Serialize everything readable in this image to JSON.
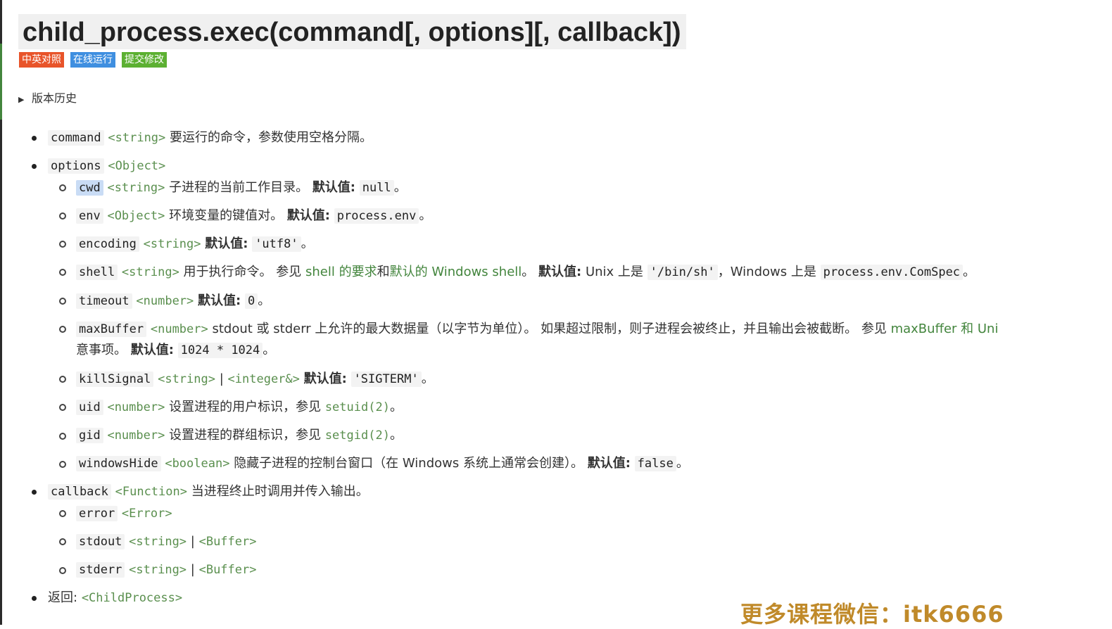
{
  "title": "child_process.exec(command[, options][, callback])",
  "badges": [
    {
      "label": "中英对照",
      "color": "#e8542a"
    },
    {
      "label": "在线运行",
      "color": "#3f8fe0"
    },
    {
      "label": "提交修改",
      "color": "#5cb032"
    }
  ],
  "history_label": "版本历史",
  "command": {
    "name": "command",
    "type": "<string>",
    "desc": "要运行的命令，参数使用空格分隔。"
  },
  "options": {
    "name": "options",
    "type": "<Object>"
  },
  "default_label": "默认值:",
  "cwd": {
    "name": "cwd",
    "type": "<string>",
    "desc": "子进程的当前工作目录。",
    "default": "null",
    "end": "。"
  },
  "env": {
    "name": "env",
    "type": "<Object>",
    "desc": "环境变量的键值对。",
    "default": "process.env",
    "end": "。"
  },
  "encoding": {
    "name": "encoding",
    "type": "<string>",
    "default": "'utf8'",
    "end": "。"
  },
  "shell": {
    "name": "shell",
    "type": "<string>",
    "desc": "用于执行命令。 参见",
    "link1": "shell 的要求",
    "and": "和",
    "link2": "默认的 Windows shell",
    "dot": "。",
    "unix_text": "Unix 上是",
    "unix_value": "'/bin/sh'",
    "win_text": "，Windows 上是",
    "win_value": "process.env.ComSpec",
    "end": "。"
  },
  "timeout": {
    "name": "timeout",
    "type": "<number>",
    "default": "0",
    "end": "。"
  },
  "maxBuffer": {
    "name": "maxBuffer",
    "type": "<number>",
    "desc": "stdout 或 stderr 上允许的最大数据量（以字节为单位）。 如果超过限制，则子进程会被终止，并且输出会被截断。 参见",
    "link": "maxBuffer 和 Uni",
    "line2": "意事项。",
    "default": "1024 * 1024",
    "end": "。"
  },
  "killSignal": {
    "name": "killSignal",
    "type1": "<string>",
    "sep": "|",
    "type2": "<integer&>",
    "default": "'SIGTERM'",
    "end": "。"
  },
  "uid": {
    "name": "uid",
    "type": "<number>",
    "desc": "设置进程的用户标识，参见",
    "ref": "setuid(2)",
    "end": "。"
  },
  "gid": {
    "name": "gid",
    "type": "<number>",
    "desc": "设置进程的群组标识，参见",
    "ref": "setgid(2)",
    "end": "。"
  },
  "windowsHide": {
    "name": "windowsHide",
    "type": "<boolean>",
    "desc": "隐藏子进程的控制台窗口（在 Windows 系统上通常会创建）。",
    "default": "false",
    "end": "。"
  },
  "callback": {
    "name": "callback",
    "type": "<Function>",
    "desc": "当进程终止时调用并传入输出。"
  },
  "error": {
    "name": "error",
    "type": "<Error>"
  },
  "stdout": {
    "name": "stdout",
    "type1": "<string>",
    "sep": "|",
    "type2": "<Buffer>"
  },
  "stderr": {
    "name": "stderr",
    "type1": "<string>",
    "sep": "|",
    "type2": "<Buffer>"
  },
  "returns": {
    "label": "返回:",
    "type": "<ChildProcess>"
  },
  "watermark": "更多课程微信：itk6666"
}
